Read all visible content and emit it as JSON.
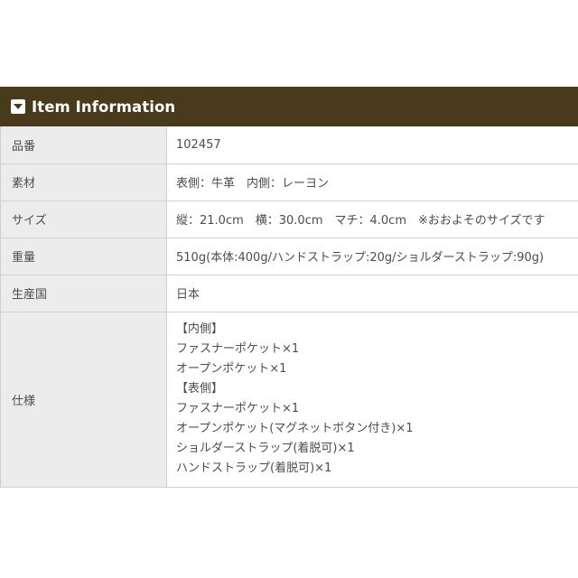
{
  "header": {
    "title": "Item Information",
    "icon": "collapse-icon"
  },
  "rows": [
    {
      "label": "品番",
      "value": "102457"
    },
    {
      "label": "素材",
      "value": "表側：牛革　内側：レーヨン"
    },
    {
      "label": "サイズ",
      "value": "縦：21.0cm　横：30.0cm　マチ：4.0cm　※おおよそのサイズです"
    },
    {
      "label": "重量",
      "value": "510g(本体:400g/ハンドストラップ:20g/ショルダーストラップ:90g)"
    },
    {
      "label": "生産国",
      "value": "日本"
    }
  ],
  "spec": {
    "label": "仕様",
    "lines": [
      "【内側】",
      "ファスナーポケット×1",
      "オープンポケット×1",
      "【表側】",
      "ファスナーポケット×1",
      "オープンポケット(マグネットボタン付き)×1",
      "ショルダーストラップ(着脱可)×1",
      "ハンドストラップ(着脱可)×1"
    ]
  },
  "colors": {
    "header_bg": "#4a3a1c",
    "label_bg": "#ececec",
    "text": "#4d4d4d"
  }
}
